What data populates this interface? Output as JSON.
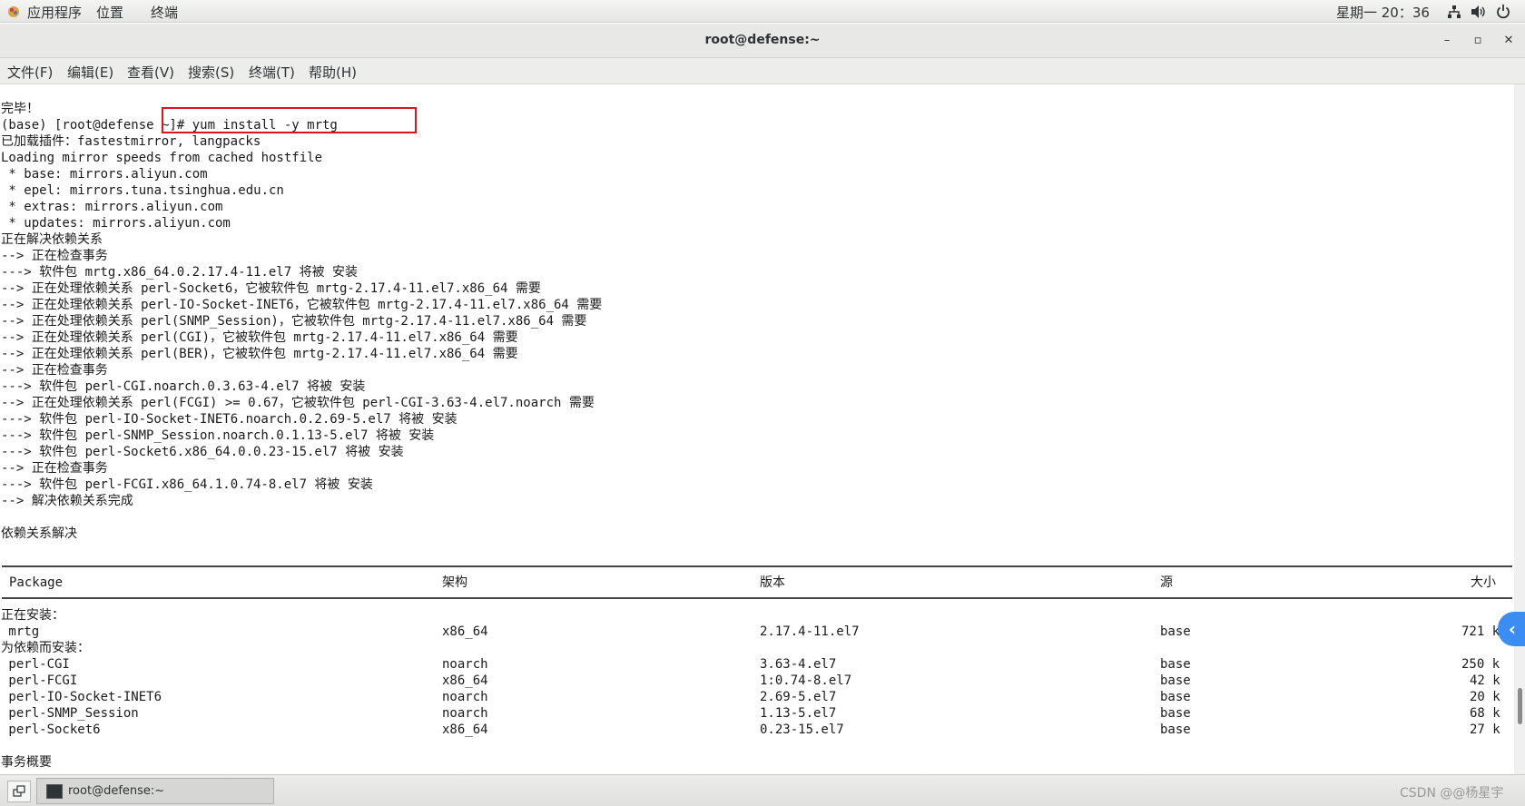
{
  "topbar": {
    "menus": [
      "应用程序",
      "位置",
      "终端"
    ],
    "clock": "星期一 20：36"
  },
  "window": {
    "title": "root@defense:~",
    "buttons": {
      "minimize": "–",
      "maximize": "▫",
      "close": "✕"
    }
  },
  "menubar": [
    "文件(F)",
    "编辑(E)",
    "查看(V)",
    "搜索(S)",
    "终端(T)",
    "帮助(H)"
  ],
  "terminal": {
    "lines": [
      "完毕！",
      "(base) [root@defense ~]# yum install -y mrtg",
      "已加载插件：fastestmirror, langpacks",
      "Loading mirror speeds from cached hostfile",
      " * base: mirrors.aliyun.com",
      " * epel: mirrors.tuna.tsinghua.edu.cn",
      " * extras: mirrors.aliyun.com",
      " * updates: mirrors.aliyun.com",
      "正在解决依赖关系",
      "--> 正在检查事务",
      "---> 软件包 mrtg.x86_64.0.2.17.4-11.el7 将被 安装",
      "--> 正在处理依赖关系 perl-Socket6，它被软件包 mrtg-2.17.4-11.el7.x86_64 需要",
      "--> 正在处理依赖关系 perl-IO-Socket-INET6，它被软件包 mrtg-2.17.4-11.el7.x86_64 需要",
      "--> 正在处理依赖关系 perl(SNMP_Session)，它被软件包 mrtg-2.17.4-11.el7.x86_64 需要",
      "--> 正在处理依赖关系 perl(CGI)，它被软件包 mrtg-2.17.4-11.el7.x86_64 需要",
      "--> 正在处理依赖关系 perl(BER)，它被软件包 mrtg-2.17.4-11.el7.x86_64 需要",
      "--> 正在检查事务",
      "---> 软件包 perl-CGI.noarch.0.3.63-4.el7 将被 安装",
      "--> 正在处理依赖关系 perl(FCGI) >= 0.67，它被软件包 perl-CGI-3.63-4.el7.noarch 需要",
      "---> 软件包 perl-IO-Socket-INET6.noarch.0.2.69-5.el7 将被 安装",
      "---> 软件包 perl-SNMP_Session.noarch.0.1.13-5.el7 将被 安装",
      "---> 软件包 perl-Socket6.x86_64.0.0.23-15.el7 将被 安装",
      "--> 正在检查事务",
      "---> 软件包 perl-FCGI.x86_64.1.0.74-8.el7 将被 安装",
      "--> 解决依赖关系完成",
      "",
      "依赖关系解决"
    ],
    "table": {
      "headers": [
        "Package",
        "架构",
        "版本",
        "源",
        "大小"
      ],
      "installing_label": "正在安装：",
      "installing": [
        {
          "name": " mrtg",
          "arch": "x86_64",
          "version": "2.17.4-11.el7",
          "repo": "base",
          "size": "721 k"
        }
      ],
      "deps_label": "为依赖而安装：",
      "deps": [
        {
          "name": " perl-CGI",
          "arch": "noarch",
          "version": "3.63-4.el7",
          "repo": "base",
          "size": "250 k"
        },
        {
          "name": " perl-FCGI",
          "arch": "x86_64",
          "version": "1:0.74-8.el7",
          "repo": "base",
          "size": "42 k"
        },
        {
          "name": " perl-IO-Socket-INET6",
          "arch": "noarch",
          "version": "2.69-5.el7",
          "repo": "base",
          "size": "20 k"
        },
        {
          "name": " perl-SNMP_Session",
          "arch": "noarch",
          "version": "1.13-5.el7",
          "repo": "base",
          "size": "68 k"
        },
        {
          "name": " perl-Socket6",
          "arch": "x86_64",
          "version": "0.23-15.el7",
          "repo": "base",
          "size": "27 k"
        }
      ]
    },
    "summary": "事务概要"
  },
  "side_handle": "‹",
  "taskbar": {
    "task_label": "root@defense:~",
    "watermark": "CSDN @@杨星宇"
  },
  "colors": {
    "highlight": "#d9161c",
    "side_handle": "#3b8df1"
  }
}
